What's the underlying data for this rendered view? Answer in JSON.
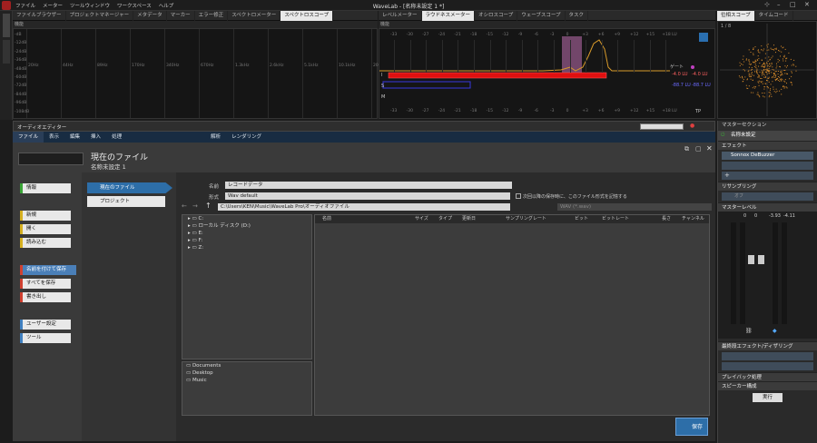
{
  "app": {
    "title": "WaveLab - [名称未設定 1 *]",
    "menu": [
      "ファイル",
      "メーター",
      "ツールウィンドウ",
      "ワークスペース",
      "ヘルプ"
    ]
  },
  "left_tabs": [
    "ファイルブラウザー",
    "プロジェクトマネージャー",
    "メタデータ",
    "マーカー",
    "エラー修正",
    "スペクトロメーター",
    "スペクトロスコープ"
  ],
  "meter_tabs": [
    "レベルメーター",
    "ラウドネスメーター",
    "オシロスコープ",
    "ウェーブスコープ",
    "タスク"
  ],
  "scope_tabs": [
    "位相スコープ",
    "タイムコード"
  ],
  "function_label": "機能",
  "spectro": {
    "x_ticks": [
      "20Hz",
      "44Hz",
      "89Hz",
      "170Hz",
      "340Hz",
      "670Hz",
      "1.3kHz",
      "2.6kHz",
      "5.1kHz",
      "10.1kHz",
      "20kHz"
    ],
    "y_ticks": [
      "-dB",
      "-12dB",
      "-24dB",
      "-36dB",
      "-48dB",
      "-60dB",
      "-72dB",
      "-84dB",
      "-96dB",
      "-108dB"
    ]
  },
  "loudness": {
    "scale": [
      "-33",
      "-30",
      "-27",
      "-24",
      "-21",
      "-18",
      "-15",
      "-12",
      "-9",
      "-6",
      "-3",
      "0",
      "+3",
      "+6",
      "+9",
      "+12",
      "+15",
      "+18 LU"
    ],
    "gate_label": "ゲート",
    "values": [
      "-4.0 LU",
      "-4.0 LU",
      "-88.7 LU",
      "-88.7 LU"
    ],
    "rows": [
      "I",
      "S",
      "M"
    ],
    "tp_label": "TP"
  },
  "phase_scale": "1 / 8",
  "editor": {
    "title": "オーディオエディター",
    "ribbon_tabs": [
      "ファイル",
      "表示",
      "編集",
      "挿入",
      "処理",
      "解析",
      "レンダリング"
    ],
    "current_file_title": "現在のファイル",
    "current_file_name": "名称未設定 1",
    "left_buttons": {
      "info": "情報",
      "new": "新規",
      "open": "開く",
      "import": "読み込む",
      "save_as": "名前を付けて保存",
      "save_all": "すべてを保存",
      "export": "書き出し",
      "prefs": "ユーザー設定",
      "tools": "ツール"
    },
    "sub_tabs": [
      "現在のファイル",
      "プロジェクト"
    ],
    "name_label": "名前",
    "name_value": "レコードデータ",
    "format_label": "形式",
    "format_value": "Wav default",
    "remember_format": "次回以降の保存時に、このファイル形式を記憶する",
    "path_value": "C:\\Users\\KEN\\Music\\WaveLab Pro\\オーディオファイル",
    "filter_placeholder": "WAV (*.wav)",
    "tree": [
      "C:",
      "ローカル ディスク (D:)",
      "E:",
      "F:",
      "Z:"
    ],
    "favorites": [
      "Documents",
      "Desktop",
      "Music"
    ],
    "columns": [
      "名前",
      "サイズ",
      "タイプ",
      "更新日",
      "サンプリングレート",
      "ビット",
      "ビットレート",
      "長さ",
      "チャンネル"
    ],
    "save_button": "保存"
  },
  "master": {
    "title": "マスターセクション",
    "preset": "名称未設定",
    "effects": "エフェクト",
    "plugin": "Sonnox DeBuzzer",
    "resampling": "リサンプリング",
    "resampling_value": "オフ",
    "level": "マスターレベル",
    "level_values": [
      "0",
      "0",
      "-3.93",
      "-4.11"
    ],
    "final_effects": "最終段エフェクト/ディザリング",
    "playback": "プレイバック処理",
    "speaker": "スピーカー構成",
    "run": "実行"
  },
  "colors": {
    "accent": "#2d6ea8",
    "ribbon": "#182c42",
    "loud_red": "#e01010",
    "loud_curve": "#d89a2a",
    "green": "#3aa537"
  }
}
